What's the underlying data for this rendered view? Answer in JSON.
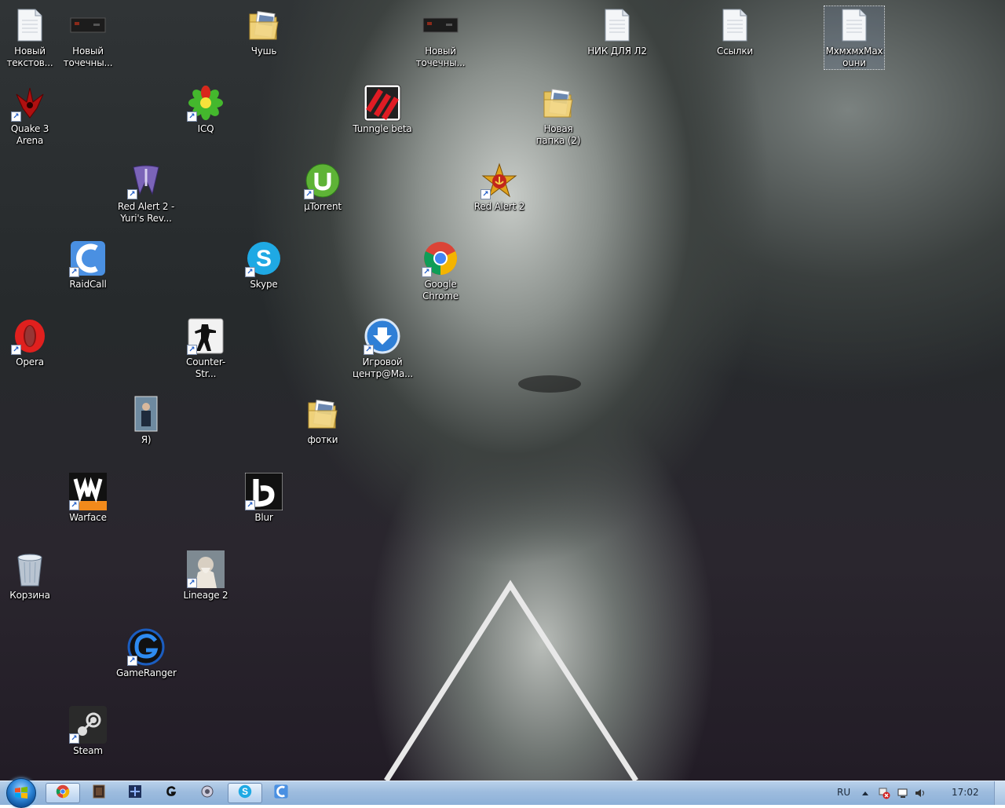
{
  "desktop": {
    "icons": [
      {
        "name": "text-file-1",
        "label": "Новый текстов...",
        "kind": "textfile",
        "shortcut": false
      },
      {
        "name": "bmp-file-1",
        "label": "Новый точечны...",
        "kind": "bmp",
        "shortcut": false
      },
      {
        "name": "folder-chush",
        "label": "Чушь",
        "kind": "folder",
        "shortcut": false
      },
      {
        "name": "bmp-file-2",
        "label": "Новый точечны...",
        "kind": "bmp",
        "shortcut": false
      },
      {
        "name": "text-file-nick",
        "label": "НИК ДЛЯ Л2",
        "kind": "textfile",
        "shortcut": false
      },
      {
        "name": "text-file-links",
        "label": "Ссылки",
        "kind": "textfile",
        "shortcut": false
      },
      {
        "name": "text-file-mxm",
        "label": "МхмхмхМах ouни",
        "kind": "textfile",
        "shortcut": false,
        "selected": true
      },
      {
        "name": "quake3",
        "label": "Quake 3 Arena",
        "kind": "quake",
        "shortcut": true
      },
      {
        "name": "icq",
        "label": "ICQ",
        "kind": "icq",
        "shortcut": true
      },
      {
        "name": "tunngle",
        "label": "Tunngle beta",
        "kind": "tunngle",
        "shortcut": false
      },
      {
        "name": "folder-new-2",
        "label": "Новая папка (2)",
        "kind": "folder",
        "shortcut": false
      },
      {
        "name": "red-alert-yuri",
        "label": "Red Alert 2 - Yuri's Rev...",
        "kind": "yuri",
        "shortcut": true
      },
      {
        "name": "utorrent",
        "label": "µTorrent",
        "kind": "utorrent",
        "shortcut": true
      },
      {
        "name": "red-alert-2",
        "label": "Red Alert 2",
        "kind": "redalert",
        "shortcut": true
      },
      {
        "name": "raidcall",
        "label": "RaidCall",
        "kind": "raidcall",
        "shortcut": true
      },
      {
        "name": "skype",
        "label": "Skype",
        "kind": "skype",
        "shortcut": true
      },
      {
        "name": "google-chrome",
        "label": "Google Chrome",
        "kind": "chrome",
        "shortcut": true
      },
      {
        "name": "opera",
        "label": "Opera",
        "kind": "opera",
        "shortcut": true
      },
      {
        "name": "counter-strike",
        "label": "Counter-Str...",
        "kind": "cs",
        "shortcut": true
      },
      {
        "name": "game-center",
        "label": "Игровой центр@Ма...",
        "kind": "gamecenter",
        "shortcut": true
      },
      {
        "name": "photo-ya",
        "label": "Я)",
        "kind": "photo",
        "shortcut": false
      },
      {
        "name": "folder-photos",
        "label": "фотки",
        "kind": "folder",
        "shortcut": false
      },
      {
        "name": "warface",
        "label": "Warface",
        "kind": "warface",
        "shortcut": true
      },
      {
        "name": "blur",
        "label": "Blur",
        "kind": "blur",
        "shortcut": true
      },
      {
        "name": "recycle-bin",
        "label": "Корзина",
        "kind": "recycle",
        "shortcut": false
      },
      {
        "name": "lineage-2",
        "label": "Lineage 2",
        "kind": "lineage",
        "shortcut": true
      },
      {
        "name": "gameranger",
        "label": "GameRanger",
        "kind": "gameranger",
        "shortcut": true
      },
      {
        "name": "steam",
        "label": "Steam",
        "kind": "steam",
        "shortcut": true
      }
    ]
  },
  "taskbar": {
    "buttons": [
      {
        "name": "chrome",
        "icon": "chrome-icon",
        "active": true
      },
      {
        "name": "app-dark",
        "icon": "window-icon",
        "active": false
      },
      {
        "name": "app-blue",
        "icon": "game-icon",
        "active": false
      },
      {
        "name": "gameranger",
        "icon": "gameranger-icon",
        "active": false
      },
      {
        "name": "tunngle",
        "icon": "tunngle-icon",
        "active": false
      },
      {
        "name": "skype",
        "icon": "skype-icon",
        "active": true
      },
      {
        "name": "raidcall",
        "icon": "raidcall-icon",
        "active": false
      }
    ],
    "tray": {
      "language": "RU",
      "time": "17:02"
    }
  }
}
